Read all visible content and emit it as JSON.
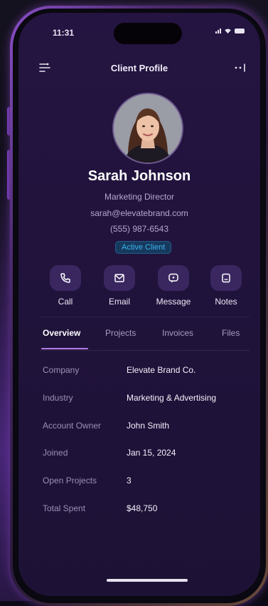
{
  "status_bar": {
    "time": "11:31"
  },
  "header": {
    "title": "Client Profile",
    "menu_icon": "filter-lines-icon",
    "more_icon": "more-dots-icon"
  },
  "profile": {
    "name": "Sarah Johnson",
    "title": "Marketing Director",
    "email": "sarah@elevatebrand.com",
    "phone": "(555) 987-6543",
    "status_badge": "Active Client"
  },
  "actions": [
    {
      "label": "Call",
      "icon": "phone-icon"
    },
    {
      "label": "Email",
      "icon": "mail-icon"
    },
    {
      "label": "Message",
      "icon": "chat-icon"
    },
    {
      "label": "Notes",
      "icon": "note-icon"
    }
  ],
  "tabs": [
    {
      "label": "Overview",
      "active": true
    },
    {
      "label": "Projects",
      "active": false
    },
    {
      "label": "Invoices",
      "active": false
    },
    {
      "label": "Files",
      "active": false
    }
  ],
  "details": [
    {
      "label": "Company",
      "value": "Elevate Brand Co."
    },
    {
      "label": "Industry",
      "value": "Marketing & Advertising"
    },
    {
      "label": "Account Owner",
      "value": "John Smith"
    },
    {
      "label": "Joined",
      "value": "Jan 15, 2024"
    },
    {
      "label": "Open Projects",
      "value": "3"
    },
    {
      "label": "Total Spent",
      "value": "$48,750"
    }
  ],
  "colors": {
    "accent": "#b27de8",
    "badge_text": "#3fb1f0",
    "screen_bg": "#21133c"
  }
}
